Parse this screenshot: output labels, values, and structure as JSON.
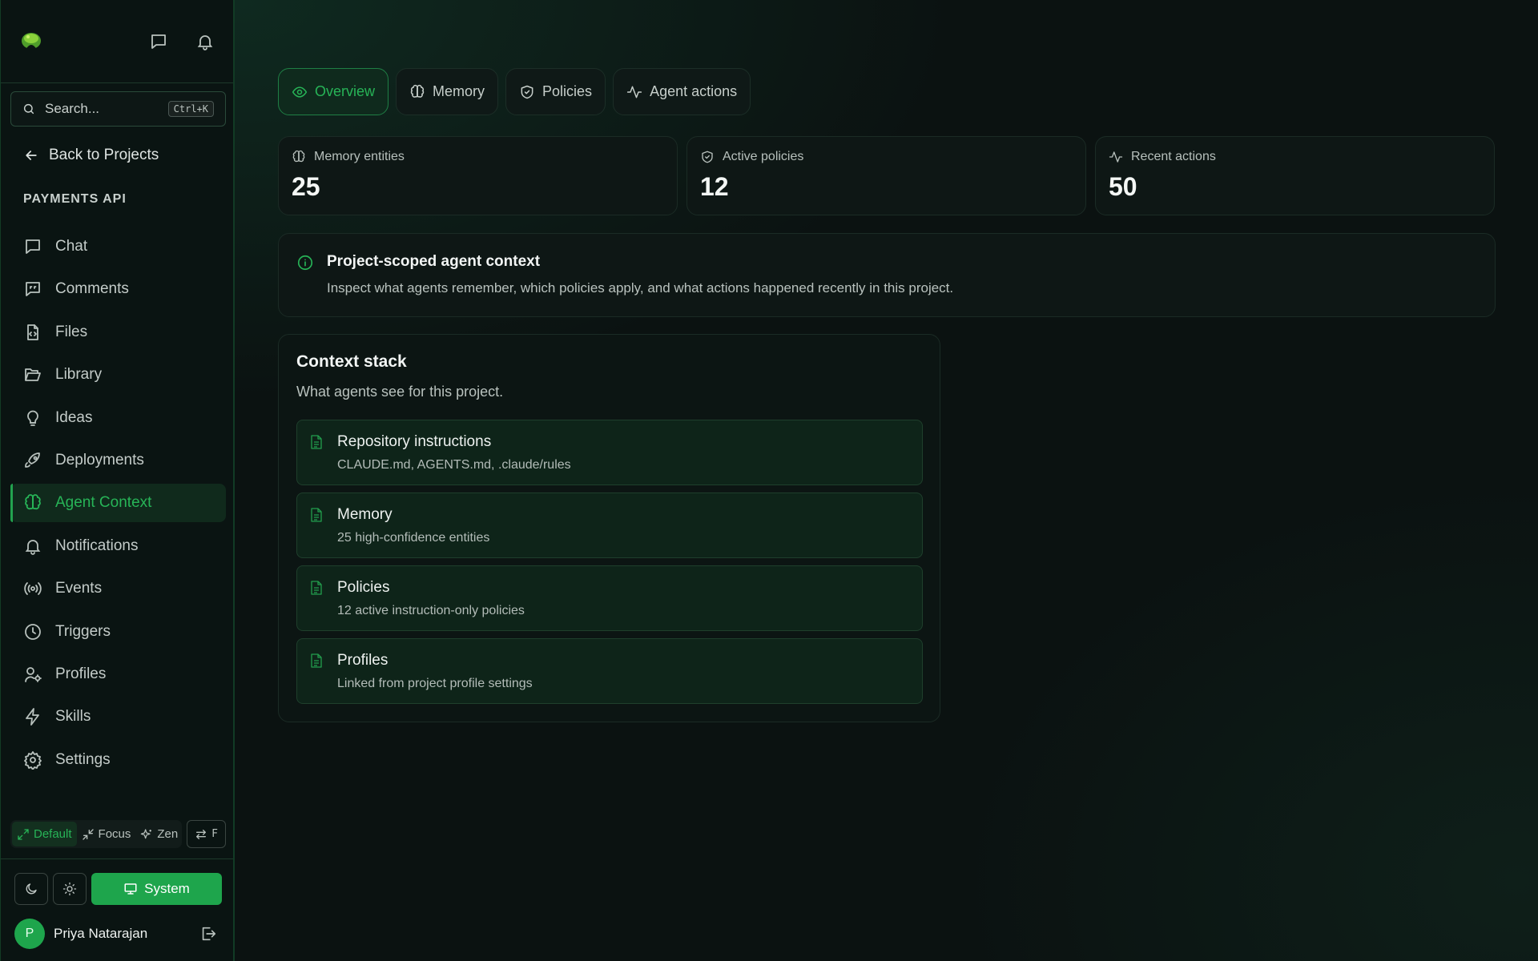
{
  "sidebar": {
    "search": {
      "placeholder": "Search...",
      "shortcut": "Ctrl+K"
    },
    "back_label": "Back to Projects",
    "project_label": "PAYMENTS API",
    "nav": [
      {
        "label": "Chat",
        "icon": "chat-icon"
      },
      {
        "label": "Comments",
        "icon": "comments-icon"
      },
      {
        "label": "Files",
        "icon": "file-code-icon"
      },
      {
        "label": "Library",
        "icon": "folder-open-icon"
      },
      {
        "label": "Ideas",
        "icon": "lightbulb-icon"
      },
      {
        "label": "Deployments",
        "icon": "rocket-icon"
      },
      {
        "label": "Agent Context",
        "icon": "brain-icon",
        "active": true
      },
      {
        "label": "Notifications",
        "icon": "bell-icon"
      },
      {
        "label": "Events",
        "icon": "radio-icon"
      },
      {
        "label": "Triggers",
        "icon": "clock-icon"
      },
      {
        "label": "Profiles",
        "icon": "user-cog-icon"
      },
      {
        "label": "Skills",
        "icon": "zap-icon"
      },
      {
        "label": "Settings",
        "icon": "gear-icon"
      }
    ],
    "modes": [
      {
        "label": "Default",
        "active": true
      },
      {
        "label": "Focus"
      },
      {
        "label": "Zen"
      }
    ],
    "swap_key": "F",
    "theme": {
      "system_label": "System"
    },
    "user": {
      "initial": "P",
      "name": "Priya Natarajan"
    }
  },
  "main": {
    "tabs": [
      {
        "label": "Overview",
        "active": true
      },
      {
        "label": "Memory"
      },
      {
        "label": "Policies"
      },
      {
        "label": "Agent actions"
      }
    ],
    "stats": [
      {
        "label": "Memory entities",
        "value": "25"
      },
      {
        "label": "Active policies",
        "value": "12"
      },
      {
        "label": "Recent actions",
        "value": "50"
      }
    ],
    "info": {
      "title": "Project-scoped agent context",
      "description": "Inspect what agents remember, which policies apply, and what actions happened recently in this project."
    },
    "context": {
      "title": "Context stack",
      "subtitle": "What agents see for this project.",
      "items": [
        {
          "title": "Repository instructions",
          "detail": "CLAUDE.md, AGENTS.md, .claude/rules"
        },
        {
          "title": "Memory",
          "detail": "25 high-confidence entities"
        },
        {
          "title": "Policies",
          "detail": "12 active instruction-only policies"
        },
        {
          "title": "Profiles",
          "detail": "Linked from project profile settings"
        }
      ]
    }
  },
  "colors": {
    "accent": "#27b457",
    "background": "#0b1211",
    "primary_button": "#1ea54c"
  }
}
